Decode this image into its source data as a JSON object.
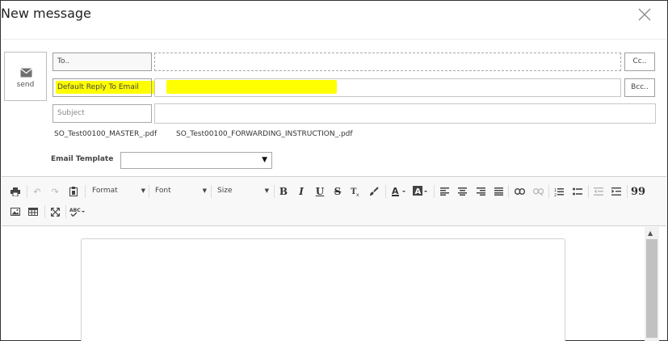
{
  "dialog": {
    "title": "New message",
    "close_icon": "close-icon"
  },
  "send": {
    "label": "send",
    "icon": "envelope-icon"
  },
  "to": {
    "label": "To..",
    "cc_label": "Cc.."
  },
  "reply": {
    "label": "Default Reply To Email",
    "bcc_label": "Bcc.."
  },
  "subject": {
    "placeholder": "Subject"
  },
  "attachments": [
    "SO_Test00100_MASTER_.pdf",
    "SO_Test00100_FORWARDING_INSTRUCTION_.pdf"
  ],
  "template": {
    "label": "Email Template",
    "value": ""
  },
  "toolbar": {
    "format_label": "Format",
    "font_label": "Font",
    "size_label": "Size",
    "bold": "B",
    "italic": "I",
    "underline": "U",
    "strike": "S",
    "blockquote": "99"
  },
  "colors": {
    "highlight": "#ffff00",
    "border": "#9e9e9e",
    "toolbar_bg": "#f8f8f8"
  }
}
